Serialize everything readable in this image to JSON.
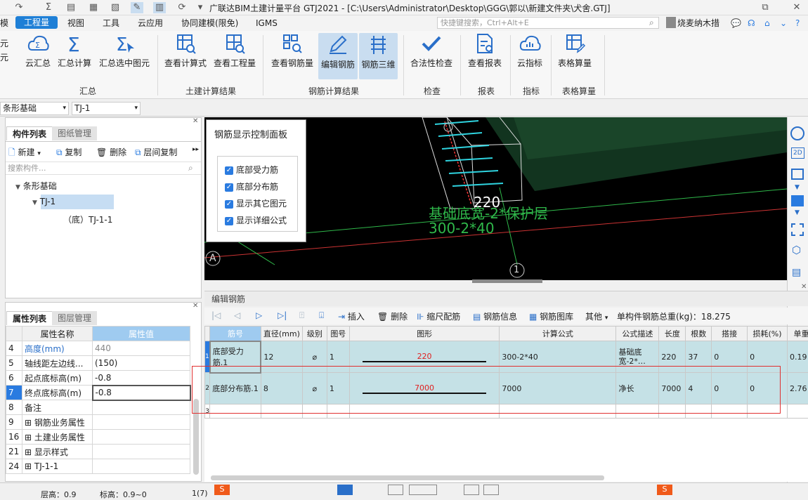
{
  "app_title": "广联达BIM土建计量平台 GTJ2021 - [C:\\Users\\Administrator\\Desktop\\GGG\\郭以\\新建文件夹\\犬舍.GTJ]",
  "menu": {
    "left_cut": "模",
    "items": [
      "工程量",
      "视图",
      "工具",
      "云应用",
      "协同建模(限免)",
      "IGMS"
    ],
    "search_placeholder": "快捷键搜索，Ctrl+Alt+E",
    "user": "烧麦纳木措"
  },
  "ribbon": {
    "buttons": {
      "yunhuizong": "云汇总",
      "huizongjisuan": "汇总计算",
      "huizongxuanzhong": "汇总选中图元",
      "chakanjisuanshi": "查看计算式",
      "chakangongchengliang": "查看工程量",
      "chakangangjinliang": "查看钢筋量",
      "bianjigangjin": "编辑钢筋",
      "gangjinsanwei": "钢筋三维",
      "hefaxing": "合法性检查",
      "chakanbaobiao": "查看报表",
      "yunzhibiao": "云指标",
      "biaogesuanliang": "表格算量"
    },
    "groups": {
      "huizong": "汇总",
      "tujian": "土建计算结果",
      "gangjin": "钢筋计算结果",
      "jiancha": "检查",
      "baobiao": "报表",
      "zhibiao": "指标",
      "biaoge": "表格算量"
    },
    "left_cut": [
      "元",
      "元"
    ]
  },
  "selectors": {
    "type": "条形基础",
    "name": "TJ-1"
  },
  "component_panel": {
    "tabs": [
      "构件列表",
      "图纸管理"
    ],
    "tools": {
      "new": "新建",
      "copy": "复制",
      "delete": "删除",
      "floor_copy": "层间复制"
    },
    "search_placeholder": "搜索构件...",
    "tree": {
      "root": "条形基础",
      "child": "TJ-1",
      "leaf": "（底）TJ-1-1"
    }
  },
  "property_panel": {
    "tabs": [
      "属性列表",
      "图层管理"
    ],
    "headers": [
      "属性名称",
      "属性值"
    ],
    "rows": [
      {
        "num": "4",
        "name": "高度(mm)",
        "value": "440"
      },
      {
        "num": "5",
        "name": "轴线距左边线...",
        "value": "(150)"
      },
      {
        "num": "6",
        "name": "起点底标高(m)",
        "value": "-0.8"
      },
      {
        "num": "7",
        "name": "终点底标高(m)",
        "value": "-0.8"
      },
      {
        "num": "8",
        "name": "备注",
        "value": ""
      },
      {
        "num": "9",
        "name": "钢筋业务属性",
        "value": ""
      },
      {
        "num": "16",
        "name": "土建业务属性",
        "value": ""
      },
      {
        "num": "21",
        "name": "显示样式",
        "value": ""
      },
      {
        "num": "24",
        "name": "TJ-1-1",
        "value": ""
      }
    ]
  },
  "viewport": {
    "control_panel": {
      "title": "钢筋显示控制面板",
      "items": [
        "底部受力筋",
        "底部分布筋",
        "显示其它图元",
        "显示详细公式"
      ]
    },
    "label_dim": "220",
    "label_formula1": "基础底宽-2*保护层",
    "label_formula2": "300-2*40",
    "axis_a": "A",
    "axis_1": "1"
  },
  "editor": {
    "title": "编辑钢筋",
    "tools": {
      "insert": "插入",
      "delete": "删除",
      "scale": "缩尺配筋",
      "info": "钢筋信息",
      "library": "钢筋图库",
      "other": "其他"
    },
    "total": "单构件钢筋总重(kg)：18.275",
    "headers": [
      "筋号",
      "直径(mm)",
      "级别",
      "图号",
      "图形",
      "计算公式",
      "公式描述",
      "长度",
      "根数",
      "搭接",
      "损耗(%)",
      "单重"
    ],
    "rows": [
      {
        "num": "1",
        "name": "底部受力筋.1",
        "dia": "12",
        "grade": "⌀",
        "fig": "1",
        "shape": "220",
        "formula": "300-2*40",
        "desc": "基础底宽-2*…",
        "len": "220",
        "count": "37",
        "lap": "0",
        "loss": "0",
        "unit": "0.19"
      },
      {
        "num": "2",
        "name": "底部分布筋.1",
        "dia": "8",
        "grade": "⌀",
        "fig": "1",
        "shape": "7000",
        "formula": "7000",
        "desc": "净长",
        "len": "7000",
        "count": "4",
        "lap": "0",
        "loss": "0",
        "unit": "2.76"
      },
      {
        "num": "3",
        "name": "",
        "dia": "",
        "grade": "",
        "fig": "",
        "shape": "",
        "formula": "",
        "desc": "",
        "len": "",
        "count": "",
        "lap": "",
        "loss": "",
        "unit": ""
      }
    ]
  },
  "status": {
    "floor": "层高：0.9",
    "elev": "标高：0.9~0",
    "page": "1(7)"
  }
}
